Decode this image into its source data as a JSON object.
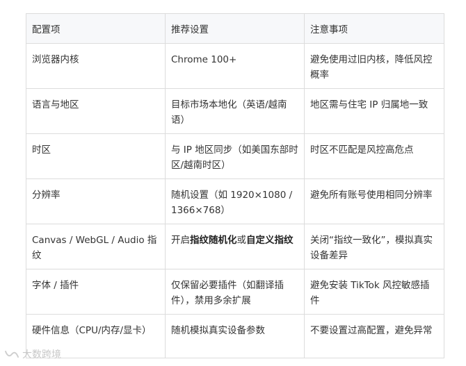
{
  "table": {
    "headers": [
      "配置项",
      "推荐设置",
      "注意事项"
    ],
    "rows": [
      {
        "item": "浏览器内核",
        "setting": "Chrome 100+",
        "note": "避免使用过旧内核，降低风控概率"
      },
      {
        "item": "语言与地区",
        "setting": "目标市场本地化（英语/越南语）",
        "note": "地区需与住宅 IP 归属地一致"
      },
      {
        "item": "时区",
        "setting": "与 IP 地区同步（如美国东部时区/越南时区）",
        "note": "时区不匹配是风控高危点"
      },
      {
        "item": "分辨率",
        "setting": "随机设置（如 1920×1080 / 1366×768）",
        "note": "避免所有账号使用相同分辨率"
      },
      {
        "item": "Canvas / WebGL / Audio 指纹",
        "setting_parts": [
          "开启",
          "指纹随机化",
          "或",
          "自定义指纹"
        ],
        "note": "关闭“指纹一致化”，模拟真实设备差异"
      },
      {
        "item": "字体 / 插件",
        "setting": "仅保留必要插件（如翻译插件），禁用多余扩展",
        "note": "避免安装 TikTok 风控敏感插件"
      },
      {
        "item": "硬件信息（CPU/内存/显卡）",
        "setting": "随机模拟真实设备参数",
        "note": "不要设置过高配置，避免异常"
      }
    ]
  },
  "watermark": {
    "text": "大数跨境",
    "icon": "brand-logo-icon"
  }
}
